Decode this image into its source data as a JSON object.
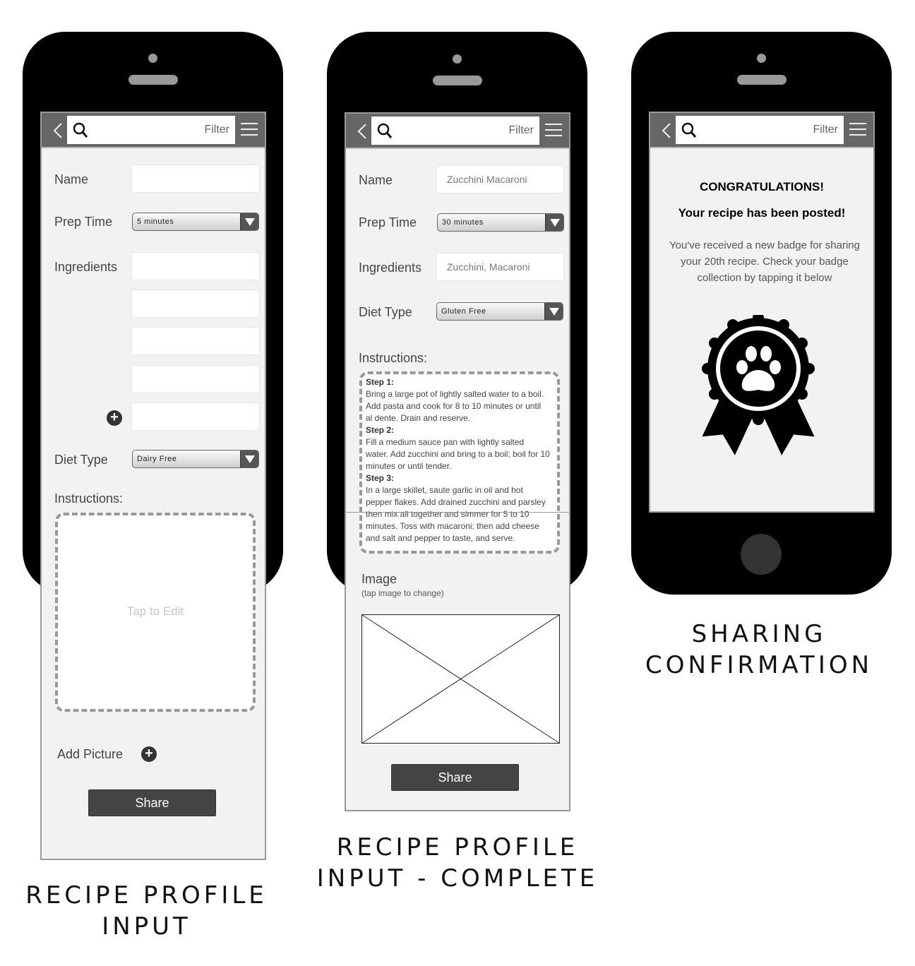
{
  "screens": [
    {
      "id": "recipe-profile-input",
      "caption": [
        "RECIPE PROFILE",
        "INPUT"
      ],
      "topbar": {
        "filter_label": "Filter"
      },
      "form": {
        "name_label": "Name",
        "name_value": "",
        "prep_time_label": "Prep Time",
        "prep_time_value": "5 minutes",
        "ingredients_label": "Ingredients",
        "diet_type_label": "Diet Type",
        "diet_type_value": "Dairy Free",
        "instructions_label": "Instructions:",
        "instructions_placeholder": "Tap to Edit",
        "add_picture_label": "Add Picture",
        "share_label": "Share"
      }
    },
    {
      "id": "recipe-profile-input-complete",
      "caption": [
        "RECIPE PROFILE",
        "INPUT - COMPLETE"
      ],
      "topbar": {
        "filter_label": "Filter"
      },
      "form": {
        "name_label": "Name",
        "name_value": "Zucchini Macaroni",
        "prep_time_label": "Prep Time",
        "prep_time_value": "30 minutes",
        "ingredients_label": "Ingredients",
        "ingredients_value": "Zucchini, Macaroni",
        "diet_type_label": "Diet Type",
        "diet_type_value": "Gluten Free",
        "instructions_label": "Instructions:",
        "instructions": [
          {
            "step": "Step 1:",
            "lines": [
              "Bring a large pot of lightly salted water to a boil.",
              "Add pasta and cook for 8 to 10 minutes or until",
              "al dente. Drain and reserve."
            ]
          },
          {
            "step": "Step 2:",
            "lines": [
              "Fill a medium sauce pan with lightly salted",
              "water. Add zucchini and bring to a boil; boil for 10",
              "minutes or until tender."
            ]
          },
          {
            "step": "Step 3:",
            "lines": [
              "In a large skillet, saute garlic in oil and hot",
              "pepper flakes. Add drained zucchini and parsley",
              "then mix all together and simmer for 5 to 10",
              "minutes. Toss with macaroni; then add cheese",
              "and salt and pepper to taste, and serve."
            ]
          }
        ],
        "image_label": "Image",
        "image_hint": "(tap image to change)",
        "share_label": "Share"
      }
    },
    {
      "id": "sharing-confirmation",
      "caption": [
        "SHARING",
        "CONFIRMATION"
      ],
      "topbar": {
        "filter_label": "Filter"
      },
      "message": {
        "title": "CONGRATULATIONS!",
        "subtitle": "Your recipe has been posted!",
        "body": "You've received a new badge for sharing your 20th recipe. Check your badge collection by tapping it below"
      },
      "badge_icon": "paw-award-ribbon-icon"
    }
  ]
}
